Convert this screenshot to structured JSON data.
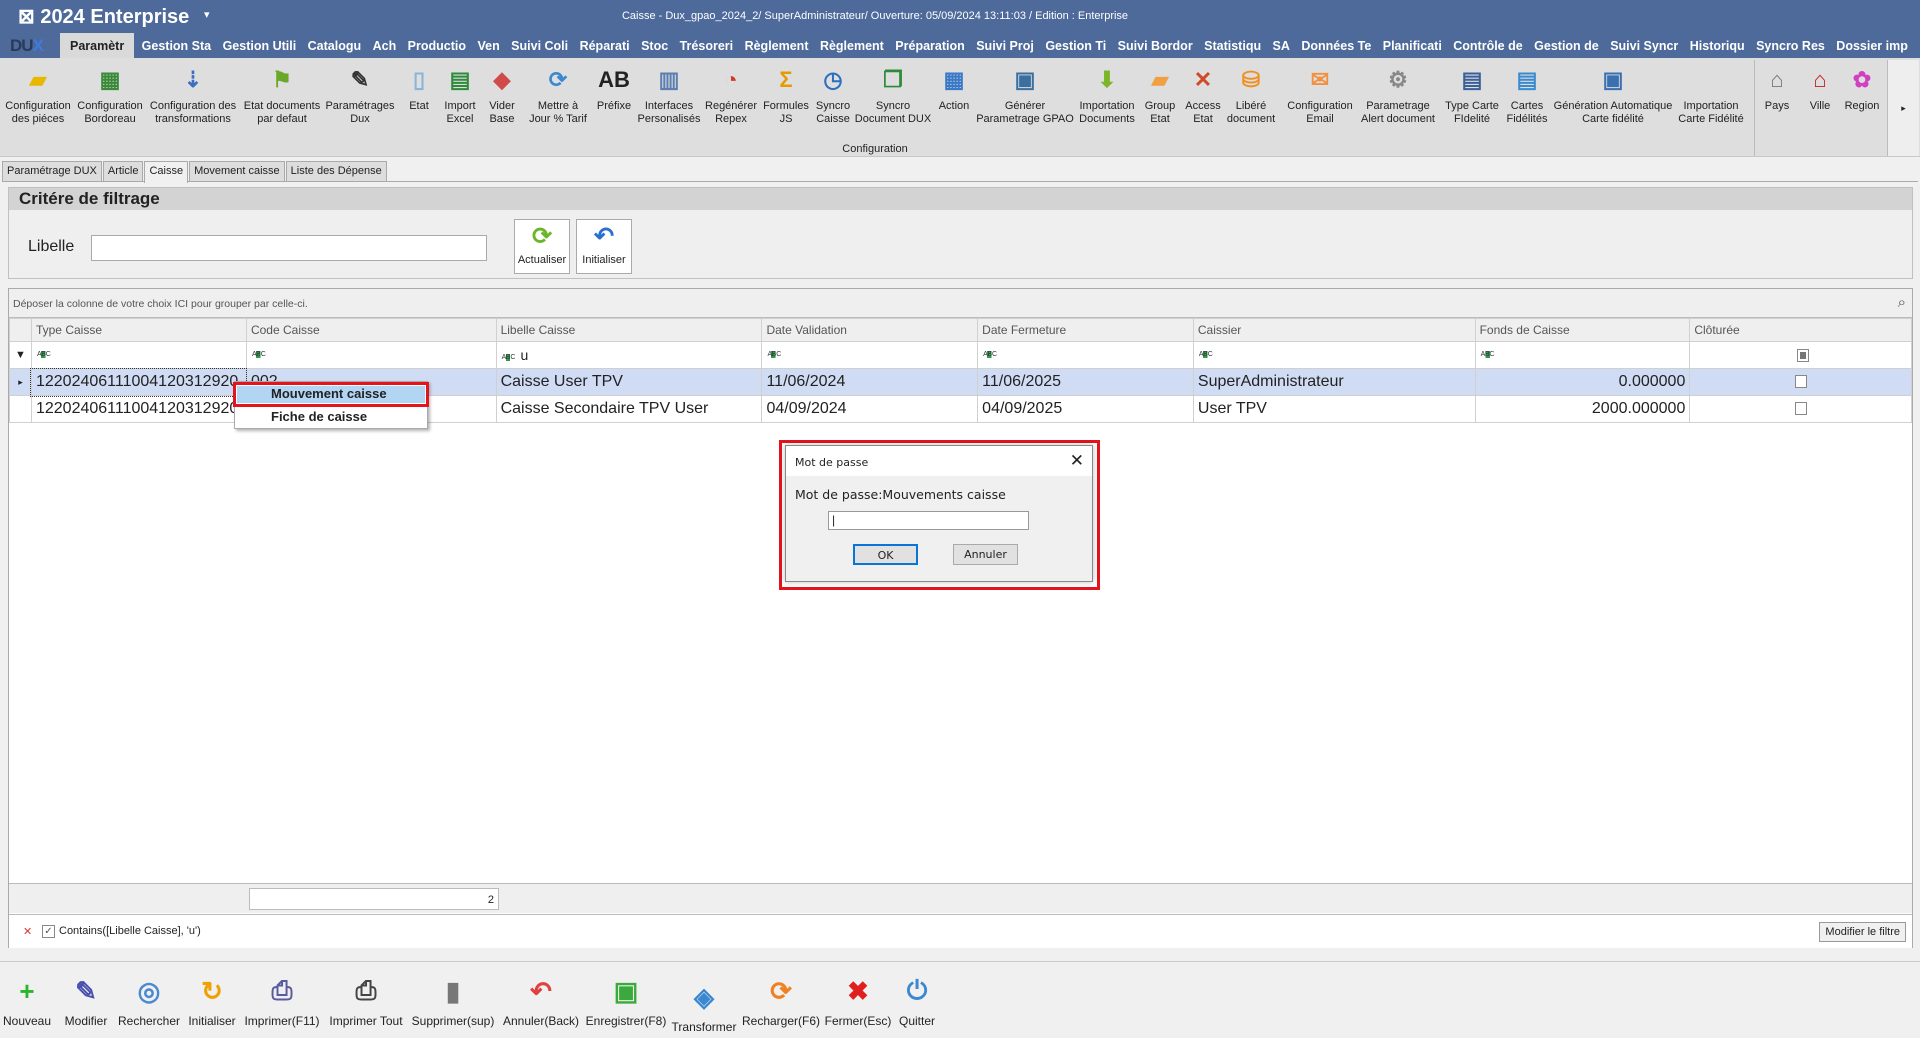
{
  "titlebar": {
    "app_title": "⊠ 2024  Enterprise",
    "caret": "▾",
    "window_title": "Caisse - Dux_gpao_2024_2/ SuperAdministrateur/ Ouverture: 05/09/2024 13:11:03 / Edition : Enterprise",
    "logo_a": "DU",
    "logo_b": "X"
  },
  "menu": [
    "Paramètr",
    "Gestion Sta",
    "Gestion Utili",
    "Catalogu",
    "Ach",
    "Productio",
    "Ven",
    "Suivi Coli",
    "Réparati",
    "Stoc",
    "Trésoreri",
    "Règlement",
    "Règlement",
    "Préparation",
    "Suivi Proj",
    "Gestion Ti",
    "Suivi Bordor",
    "Statistiqu",
    "SA",
    "Données Te",
    "Planificati",
    "Contrôle de",
    "Gestion de",
    "Suivi Syncr",
    "Historiqu",
    "Syncro Res",
    "Dossier imp"
  ],
  "ribbon": {
    "group_label": "Configuration",
    "items": [
      {
        "l1": "Configuration",
        "l2": "des piéces",
        "icon": "folder-icon",
        "glyph": "▰",
        "color": "#e6b800"
      },
      {
        "l1": "Configuration",
        "l2": "Bordoreau",
        "icon": "grid-icon",
        "glyph": "▦",
        "color": "#3a8a3a"
      },
      {
        "l1": "Configuration des",
        "l2": "transformations",
        "icon": "sort-list-icon",
        "glyph": "⇣",
        "color": "#3a6fc0"
      },
      {
        "l1": "Etat documents",
        "l2": "par defaut",
        "icon": "flag-icon",
        "glyph": "⚑",
        "color": "#6aa82a"
      },
      {
        "l1": "Paramétrages",
        "l2": "Dux",
        "icon": "spelling-pen-icon",
        "glyph": "✎",
        "color": "#333"
      },
      {
        "l1": "Etat",
        "l2": "",
        "icon": "document-icon",
        "glyph": "▯",
        "color": "#8ab4d8"
      },
      {
        "l1": "Import",
        "l2": "Excel",
        "icon": "excel-icon",
        "glyph": "▤",
        "color": "#2e8b3a"
      },
      {
        "l1": "Vider",
        "l2": "Base",
        "icon": "eraser-icon",
        "glyph": "◆",
        "color": "#d04a4a"
      },
      {
        "l1": "Mettre à",
        "l2": "Jour % Tarif",
        "icon": "refresh-icon",
        "glyph": "⟳",
        "color": "#3a88d0"
      },
      {
        "l1": "Préfixe",
        "l2": "",
        "icon": "ab-text-icon",
        "glyph": "AB",
        "color": "#222"
      },
      {
        "l1": "Interfaces",
        "l2": "Personalisés",
        "icon": "chart-window-icon",
        "glyph": "▥",
        "color": "#5a7fb0"
      },
      {
        "l1": "Regénérer",
        "l2": "Repex",
        "icon": "chart-clock-icon",
        "glyph": "◔",
        "color": "#d03a2a"
      },
      {
        "l1": "Formules",
        "l2": "JS",
        "icon": "sigma-icon",
        "glyph": "Σ",
        "color": "#e69a00"
      },
      {
        "l1": "Syncro",
        "l2": "Caisse",
        "icon": "history-icon",
        "glyph": "◷",
        "color": "#2a6fc0"
      },
      {
        "l1": "Syncro",
        "l2": "Document DUX",
        "icon": "copy-icon",
        "glyph": "❐",
        "color": "#2e8b3a"
      },
      {
        "l1": "Action",
        "l2": "",
        "icon": "table-star-icon",
        "glyph": "▦",
        "color": "#3a78c8"
      },
      {
        "l1": "Générer",
        "l2": "Parametrage GPAO",
        "icon": "calendar-timer-icon",
        "glyph": "▣",
        "color": "#3a6fa0"
      },
      {
        "l1": "Importation",
        "l2": "Documents",
        "icon": "download-arrow-icon",
        "glyph": "⬇",
        "color": "#7ab52a"
      },
      {
        "l1": "Group",
        "l2": "Etat",
        "icon": "open-folder-icon",
        "glyph": "▰",
        "color": "#f0a040"
      },
      {
        "l1": "Access",
        "l2": "Etat",
        "icon": "network-icon",
        "glyph": "✕",
        "color": "#d04a2a"
      },
      {
        "l1": "Libéré",
        "l2": "document",
        "icon": "database-sync-icon",
        "glyph": "⛁",
        "color": "#f09020"
      },
      {
        "l1": "Configuration",
        "l2": "Email",
        "icon": "email-add-icon",
        "glyph": "✉",
        "color": "#f09040"
      },
      {
        "l1": "Parametrage",
        "l2": "Alert document",
        "icon": "table-gear-icon",
        "glyph": "⚙",
        "color": "#888"
      },
      {
        "l1": "Type Carte",
        "l2": "FIdelité",
        "icon": "id-card-pen-icon",
        "glyph": "▤",
        "color": "#3a5f9a"
      },
      {
        "l1": "Cartes",
        "l2": "Fidélités",
        "icon": "document-add-icon",
        "glyph": "▤",
        "color": "#3a8ad0"
      },
      {
        "l1": "Génération Automatique",
        "l2": "Carte fidélité",
        "icon": "contact-card-icon",
        "glyph": "▣",
        "color": "#3a6fb0"
      },
      {
        "l1": "Importation",
        "l2": "Carte Fidélité",
        "icon": "import-card-icon",
        "glyph": "",
        "color": "#888"
      }
    ],
    "items2": [
      {
        "l1": "Pays",
        "icon": "house-icon",
        "glyph": "⌂",
        "color": "#777"
      },
      {
        "l1": "Ville",
        "icon": "red-house-icon",
        "glyph": "⌂",
        "color": "#c02020"
      },
      {
        "l1": "Region",
        "icon": "color-wheel-icon",
        "glyph": "✿",
        "color": "#d040c0"
      }
    ],
    "scroll": "▸"
  },
  "doc_tabs": [
    "Paramétrage DUX",
    "Article",
    "Caisse",
    "Movement caisse",
    "Liste des Dépense"
  ],
  "active_doc_tab": 2,
  "filter": {
    "title": "Critére de filtrage",
    "libelle_label": "Libelle",
    "libelle_value": "",
    "refresh": "Actualiser",
    "reset": "Initialiser"
  },
  "grid": {
    "group_hint": "Déposer la colonne de votre choix ICI pour grouper par celle-ci.",
    "columns": [
      "Type Caisse",
      "Code Caisse",
      "Libelle Caisse",
      "Date Validation",
      "Date Fermeture",
      "Caissier",
      "Fonds de Caisse",
      "Clôturée"
    ],
    "filter_row": {
      "libelle": "u",
      "abc": "A B C"
    },
    "rows": [
      {
        "type": "12202406111004120312920",
        "code": "002",
        "libelle": "Caisse User TPV",
        "date_validation": "11/06/2024",
        "date_fermeture": "11/06/2025",
        "caissier": "SuperAdministrateur",
        "fonds": "0.000000",
        "cloturee": false,
        "selected": true
      },
      {
        "type": "12202406111004120312920",
        "code": "",
        "libelle": "Caisse Secondaire TPV User",
        "date_validation": "04/09/2024",
        "date_fermeture": "04/09/2025",
        "caissier": "User TPV",
        "fonds": "2000.000000",
        "cloturee": false,
        "selected": false
      }
    ],
    "count": "2",
    "active_filter": "Contains([Libelle Caisse], 'u')",
    "modify_filter": "Modifier le filtre"
  },
  "context_menu": [
    "Mouvement caisse",
    "Fiche de caisse"
  ],
  "dialog": {
    "title": "Mot de passe",
    "prompt": "Mot de passe:Mouvements caisse",
    "value": "",
    "ok": "OK",
    "cancel": "Annuler"
  },
  "bottom_toolbar": [
    {
      "label": "Nouveau",
      "icon": "add-icon",
      "glyph": "+",
      "color": "#2bb52b"
    },
    {
      "label": "Modifier",
      "icon": "edit-icon",
      "glyph": "✎",
      "color": "#4a50b0"
    },
    {
      "label": "Rechercher",
      "icon": "search-globe-icon",
      "glyph": "◎",
      "color": "#4a8ad0"
    },
    {
      "label": "Initialiser",
      "icon": "reset-icon",
      "glyph": "↻",
      "color": "#f0a000"
    },
    {
      "label": "Imprimer(F11)",
      "icon": "printer-icon",
      "glyph": "⎙",
      "color": "#5a5aa0"
    },
    {
      "label": "Imprimer Tout",
      "icon": "print-all-icon",
      "glyph": "⎙",
      "color": "#444"
    },
    {
      "label": "Supprimer(sup)",
      "icon": "trash-icon",
      "glyph": "▮",
      "color": "#777"
    },
    {
      "label": "Annuler(Back)",
      "icon": "undo-icon",
      "glyph": "↶",
      "color": "#e04040"
    },
    {
      "label": "Enregistrer(F8)",
      "icon": "save-icon",
      "glyph": "▣",
      "color": "#3aaa3a"
    },
    {
      "label": "Transformer",
      "icon": "transform-icon",
      "glyph": "◈",
      "color": "#3a88d0"
    },
    {
      "label": "Recharger(F6)",
      "icon": "reload-icon",
      "glyph": "⟳",
      "color": "#f08020"
    },
    {
      "label": "Fermer(Esc)",
      "icon": "close-red-icon",
      "glyph": "✖",
      "color": "#e02020"
    },
    {
      "label": "Quitter",
      "icon": "power-icon",
      "glyph": "⏻",
      "color": "#3a88d0"
    }
  ]
}
